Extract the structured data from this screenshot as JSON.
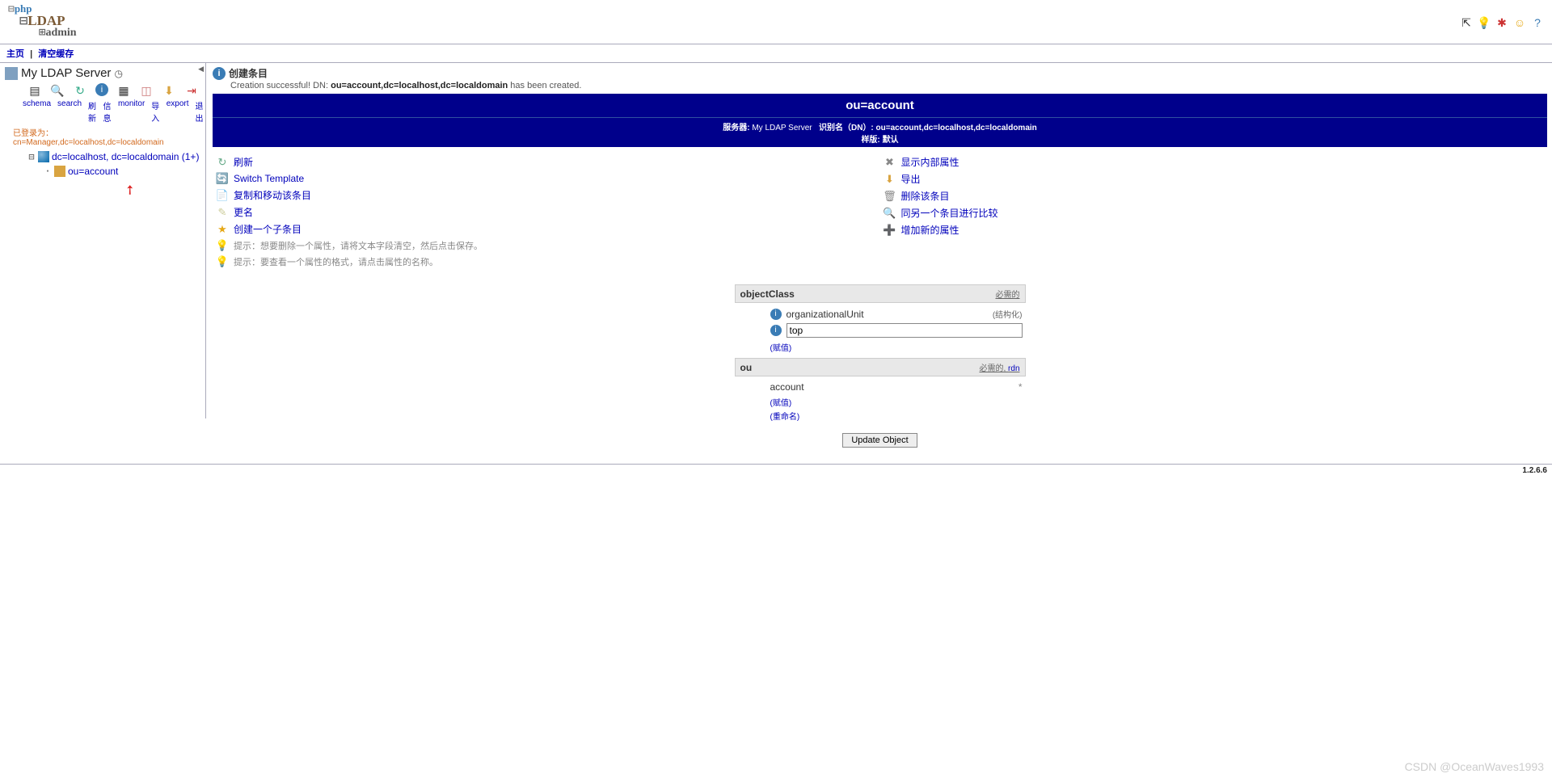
{
  "logo": {
    "l1": "php",
    "l2": "LDAP",
    "l3": "admin"
  },
  "nav": {
    "home": "主页",
    "clear": "清空缓存"
  },
  "server": {
    "name": "My LDAP Server",
    "links": [
      "schema",
      "search",
      "刷新",
      "信息",
      "monitor",
      "导入",
      "export",
      "退出"
    ],
    "login_label": "已登录为：",
    "login_dn": "cn=Manager,dc=localhost,dc=localdomain"
  },
  "tree": {
    "root": "dc=localhost, dc=localdomain (1+)",
    "child": "ou=account"
  },
  "msg": {
    "title": "创建条目",
    "l1": "Creation successful! DN: ",
    "dn": "ou=account,dc=localhost,dc=localdomain",
    "l2": " has been created."
  },
  "entry": {
    "title": "ou=account",
    "srv_label": "服务器:",
    "srv": "My LDAP Server",
    "dn_label": "识别名（DN）:",
    "dn": "ou=account,dc=localhost,dc=localdomain",
    "tpl_label": "样版:",
    "tpl": "默认"
  },
  "actionsL": [
    {
      "icon": "↻",
      "label": "刷新",
      "k": "refresh",
      "col": "#6a8"
    },
    {
      "icon": "🔄",
      "label": "Switch Template",
      "k": "switch-template",
      "col": "#777"
    },
    {
      "icon": "📄",
      "label": "复制和移动该条目",
      "k": "copy-move",
      "col": "#8aa"
    },
    {
      "icon": "✎",
      "label": "更名",
      "k": "rename",
      "col": "#cc9"
    },
    {
      "icon": "★",
      "label": "创建一个子条目",
      "k": "create-child",
      "col": "#e6a816"
    }
  ],
  "actionsR": [
    {
      "icon": "✖",
      "label": "显示内部属性",
      "k": "show-internal",
      "col": "#888"
    },
    {
      "icon": "⬇",
      "label": "导出",
      "k": "export",
      "col": "#d9a441"
    },
    {
      "icon": "🗑",
      "label": "删除该条目",
      "k": "delete",
      "col": "#888"
    },
    {
      "icon": "🔍",
      "label": "同另一个条目进行比较",
      "k": "compare",
      "col": "#888"
    },
    {
      "icon": "➕",
      "label": "增加新的属性",
      "k": "add-attr",
      "col": "#888"
    }
  ],
  "hints": [
    "提示：想要删除一个属性，请将文本字段清空，然后点击保存。",
    "提示：要查看一个属性的格式，请点击属性的名称。"
  ],
  "attrs": {
    "oc": {
      "name": "objectClass",
      "req": "必需的",
      "v1": "organizationalUnit",
      "struct": "(结构化)",
      "v2": "top",
      "add": "(赋值)"
    },
    "ou": {
      "name": "ou",
      "req": "必需的",
      "rdn": "rdn",
      "val": "account",
      "add": "(赋值)",
      "alias": "(重命名)"
    }
  },
  "btn": "Update Object",
  "version": "1.2.6.6",
  "water": "CSDN @OceanWaves1993"
}
